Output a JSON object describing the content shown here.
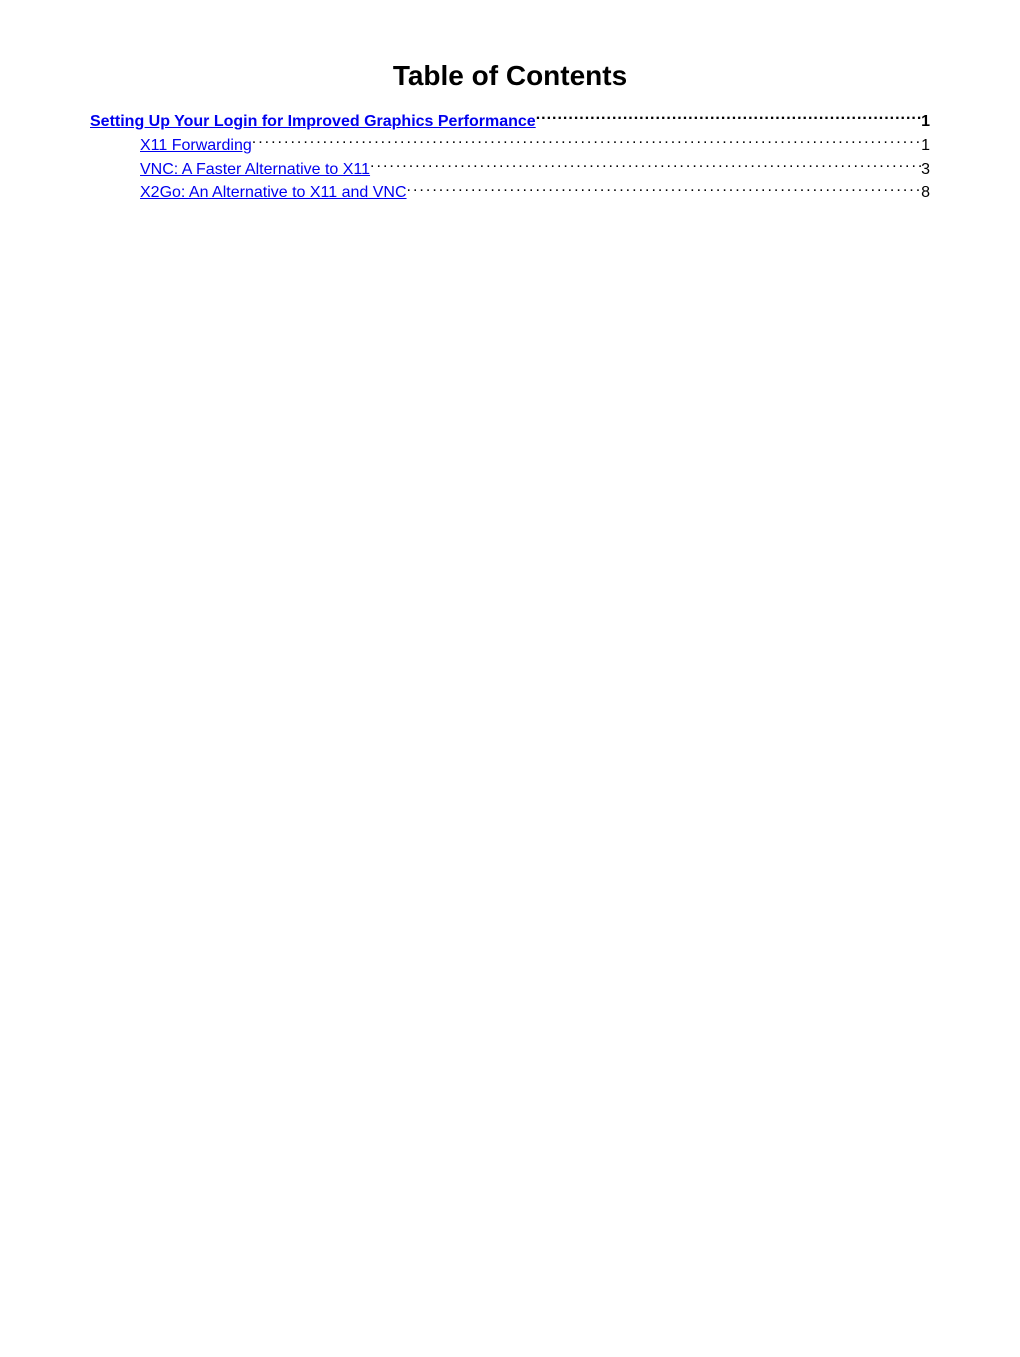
{
  "title": "Table of Contents",
  "toc": [
    {
      "level": 0,
      "label": "Setting Up Your Login for Improved Graphics Performance",
      "page": "1"
    },
    {
      "level": 1,
      "label": "X11 Forwarding",
      "page": "1"
    },
    {
      "level": 1,
      "label": "VNC: A Faster Alternative to X11",
      "page": "3"
    },
    {
      "level": 1,
      "label": "X2Go: An Alternative to X11 and VNC",
      "page": "8"
    }
  ]
}
